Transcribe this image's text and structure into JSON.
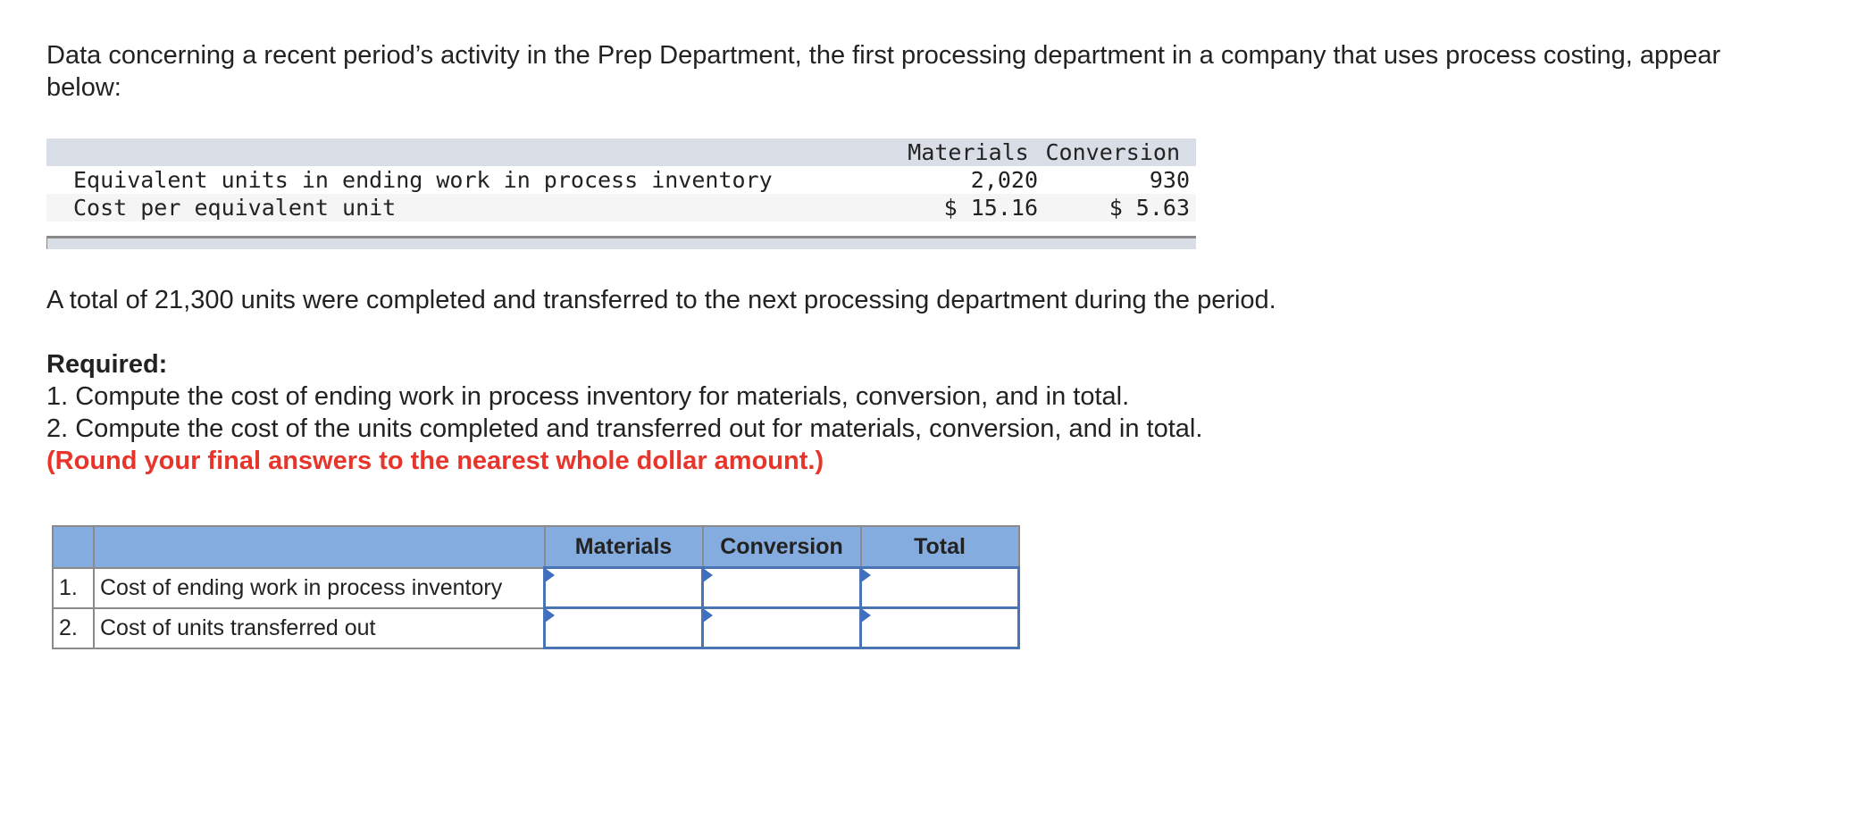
{
  "intro": "Data concerning a recent period’s activity in the Prep Department, the first processing department in a company that uses process costing, appear below:",
  "data_table": {
    "headers": [
      "",
      "Materials",
      "Conversion"
    ],
    "rows": [
      {
        "label": "Equivalent units in ending work in process inventory",
        "materials": "2,020",
        "conversion": "930"
      },
      {
        "label": "Cost per equivalent unit",
        "materials": "$ 15.16",
        "conversion": "$ 5.63"
      }
    ]
  },
  "total_line": "A total of 21,300 units were completed and transferred to the next processing department during the period.",
  "required": {
    "title": "Required:",
    "items": [
      "1. Compute the cost of ending work in process inventory for materials, conversion, and in total.",
      "2. Compute the cost of the units completed and transferred out for materials, conversion, and in total."
    ],
    "note": "(Round your final answers to the nearest whole dollar amount.)",
    "note_color": "#e8352b"
  },
  "answer_table": {
    "headers": [
      "",
      "",
      "Materials",
      "Conversion",
      "Total"
    ],
    "header_color": "#84acdf",
    "rows": [
      {
        "num": "1.",
        "label": "Cost of ending work in process inventory",
        "materials": "",
        "conversion": "",
        "total": ""
      },
      {
        "num": "2.",
        "label": "Cost of units transferred out",
        "materials": "",
        "conversion": "",
        "total": ""
      }
    ]
  }
}
